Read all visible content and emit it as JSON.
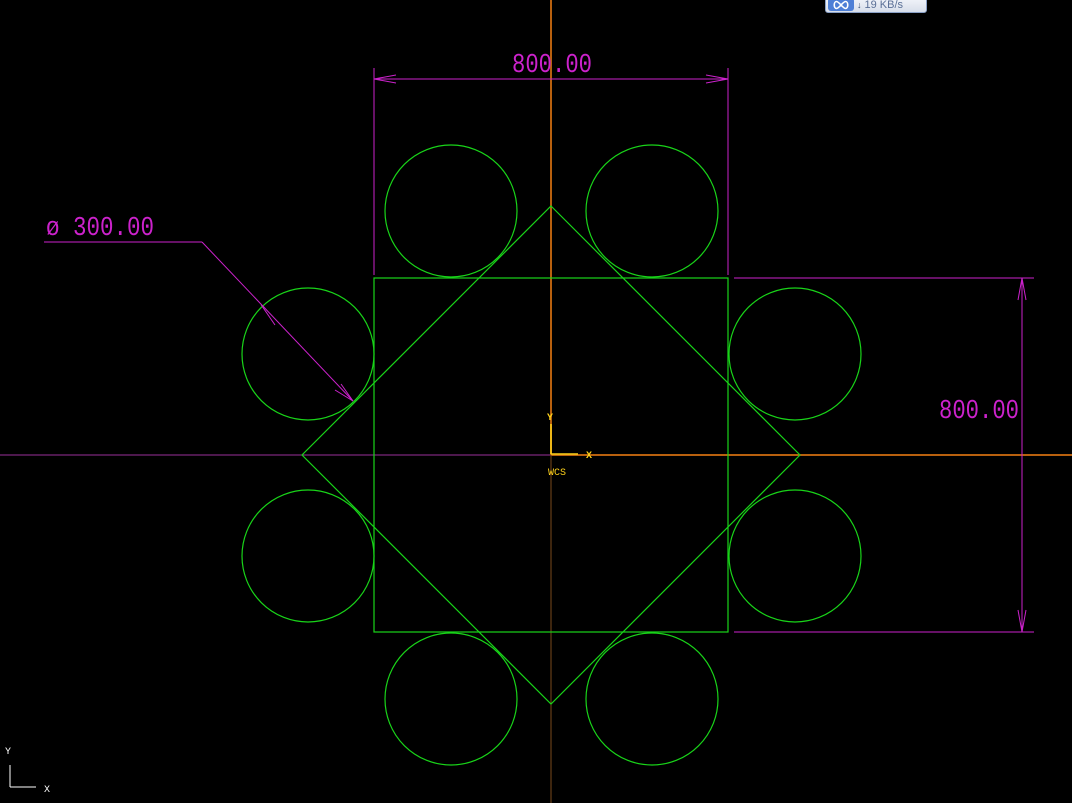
{
  "colors": {
    "background": "#000000",
    "geometry": "#19d419",
    "dimension": "#cc22cc",
    "wcs_axes": "#ffd21a",
    "axis_line": "#b8600e",
    "vertical_axis": "#7a4a1c",
    "crosshair_h": "#9a309a"
  },
  "dimensions": {
    "top_width": "800.00",
    "right_height": "800.00",
    "diameter": "ø 300.00"
  },
  "wcs": {
    "y_label": "Y",
    "x_label": "X",
    "name": "WCS"
  },
  "corner_axes": {
    "y_label": "Y",
    "x_label": "X"
  },
  "net_indicator": {
    "icon": "infinity-link-icon",
    "arrow": "↓",
    "rate": "19 KB/s"
  }
}
